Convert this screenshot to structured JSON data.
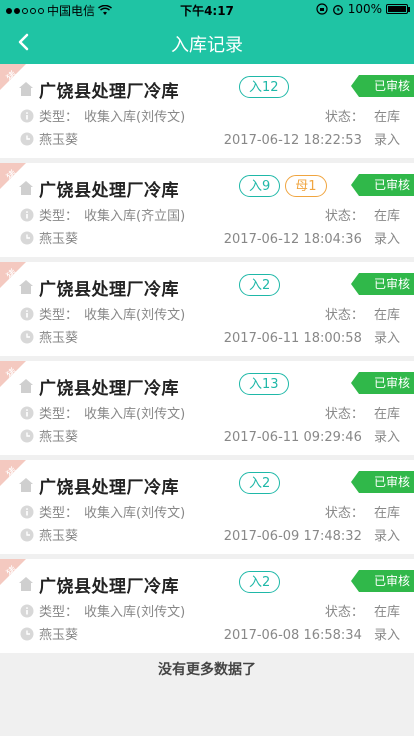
{
  "status_bar": {
    "carrier": "中国电信",
    "time": "下午4:17",
    "battery": "100%",
    "battery_level": 1.0
  },
  "nav": {
    "title": "入库记录"
  },
  "records": [
    {
      "corner_label": "猪",
      "name": "广饶县处理厂冷库",
      "tags": [
        {
          "label": "入12",
          "kind": "in"
        }
      ],
      "audit": "已审核",
      "type_label": "类型：",
      "type_value": "收集入库(刘传文)",
      "status_label": "状态：",
      "status_value": "在库",
      "person": "燕玉葵",
      "datetime": "2017-06-12 18:22:53",
      "action": "录入"
    },
    {
      "corner_label": "猪",
      "name": "广饶县处理厂冷库",
      "tags": [
        {
          "label": "入9",
          "kind": "in"
        },
        {
          "label": "母1",
          "kind": "mu"
        }
      ],
      "audit": "已审核",
      "type_label": "类型：",
      "type_value": "收集入库(齐立国)",
      "status_label": "状态：",
      "status_value": "在库",
      "person": "燕玉葵",
      "datetime": "2017-06-12 18:04:36",
      "action": "录入"
    },
    {
      "corner_label": "猪",
      "name": "广饶县处理厂冷库",
      "tags": [
        {
          "label": "入2",
          "kind": "in"
        }
      ],
      "audit": "已审核",
      "type_label": "类型：",
      "type_value": "收集入库(刘传文)",
      "status_label": "状态：",
      "status_value": "在库",
      "person": "燕玉葵",
      "datetime": "2017-06-11 18:00:58",
      "action": "录入"
    },
    {
      "corner_label": "猪",
      "name": "广饶县处理厂冷库",
      "tags": [
        {
          "label": "入13",
          "kind": "in"
        }
      ],
      "audit": "已审核",
      "type_label": "类型：",
      "type_value": "收集入库(刘传文)",
      "status_label": "状态：",
      "status_value": "在库",
      "person": "燕玉葵",
      "datetime": "2017-06-11 09:29:46",
      "action": "录入"
    },
    {
      "corner_label": "猪",
      "name": "广饶县处理厂冷库",
      "tags": [
        {
          "label": "入2",
          "kind": "in"
        }
      ],
      "audit": "已审核",
      "type_label": "类型：",
      "type_value": "收集入库(刘传文)",
      "status_label": "状态：",
      "status_value": "在库",
      "person": "燕玉葵",
      "datetime": "2017-06-09 17:48:32",
      "action": "录入"
    },
    {
      "corner_label": "猪",
      "name": "广饶县处理厂冷库",
      "tags": [
        {
          "label": "入2",
          "kind": "in"
        }
      ],
      "audit": "已审核",
      "type_label": "类型：",
      "type_value": "收集入库(刘传文)",
      "status_label": "状态：",
      "status_value": "在库",
      "person": "燕玉葵",
      "datetime": "2017-06-08 16:58:34",
      "action": "录入"
    }
  ],
  "footer": {
    "text": "没有更多数据了"
  },
  "colors": {
    "header": "#1fc4a4",
    "tag_in": "#1fb8a8",
    "tag_mu": "#f0a540",
    "audit": "#30b84a",
    "corner": "#f4c9c0"
  },
  "icons": [
    "back-icon",
    "house-icon",
    "info-icon",
    "clock-icon",
    "wifi-icon",
    "alarm-icon",
    "lock-rotation-icon"
  ]
}
